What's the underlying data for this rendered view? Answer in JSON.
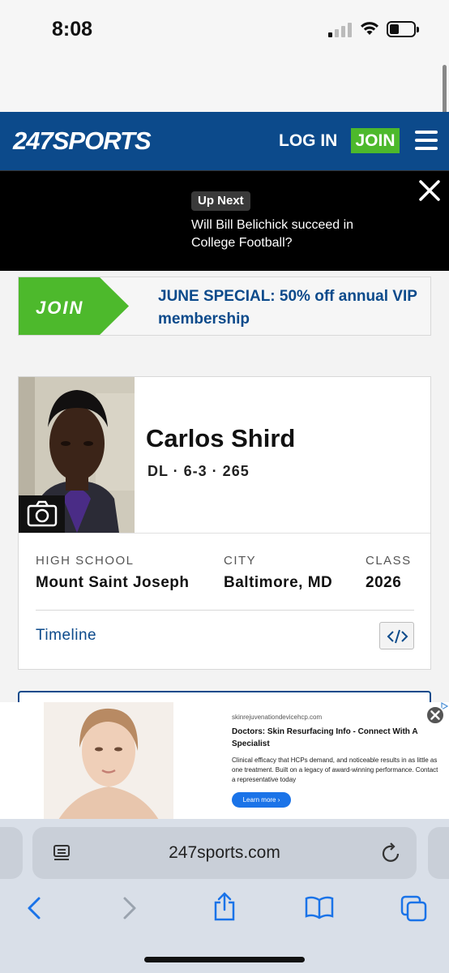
{
  "status_bar": {
    "time": "8:08"
  },
  "header": {
    "logo_num": "247",
    "logo_word": "SPORTS",
    "login_label": "LOG IN",
    "join_label": "JOIN",
    "colors": {
      "brand_blue": "#0c4a8b",
      "join_green": "#4db92c"
    }
  },
  "up_next": {
    "badge": "Up Next",
    "title": "Will Bill Belichick succeed in College Football?"
  },
  "promo": {
    "join_label": "JOIN",
    "text": "JUNE SPECIAL: 50% off annual VIP membership"
  },
  "player": {
    "name": "Carlos Shird",
    "meta": "DL · 6-3 · 265",
    "high_school_label": "HIGH SCHOOL",
    "high_school": "Mount Saint Joseph",
    "city_label": "CITY",
    "city": "Baltimore, MD",
    "class_label": "CLASS",
    "class_year": "2026",
    "timeline_label": "Timeline"
  },
  "ad": {
    "domain": "skinrejuvenationdevicehcp.com",
    "title": "Doctors: Skin Resurfacing Info - Connect With A Specialist",
    "body": "Clinical efficacy that HCPs demand, and noticeable results in as little as one treatment. Built on a legacy of award-winning performance. Contact a representative today",
    "cta": "Learn more ›"
  },
  "browser": {
    "url": "247sports.com"
  }
}
